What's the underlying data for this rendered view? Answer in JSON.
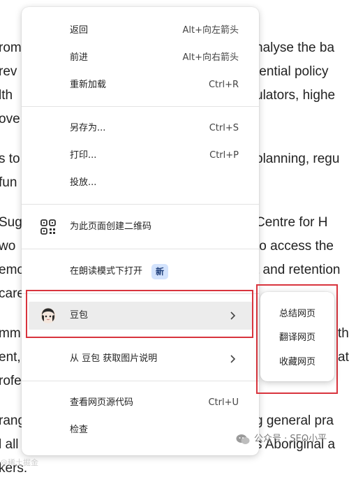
{
  "background_text": [
    {
      "left": "rom",
      "right": "nalyse the ba"
    },
    {
      "left": "rev",
      "right": "tential policy"
    },
    {
      "left": "lth",
      "right": "ulators, highe"
    },
    {
      "left": "ove",
      "right": ""
    },
    {
      "left": "s to",
      "right": "planning, regu"
    },
    {
      "left": "fun",
      "right": ""
    },
    {
      "left": "Sug",
      "right": "Centre for H"
    },
    {
      "left": " wo",
      "right": "to access the"
    },
    {
      "left": "emo",
      "right": "t and retention"
    },
    {
      "left": "care",
      "right": ""
    },
    {
      "left": "mm",
      "right": "th"
    },
    {
      "left": "ent,",
      "right": "at"
    },
    {
      "left": "rofe",
      "right": ""
    },
    {
      "left": "rang",
      "right": "g general pra"
    },
    {
      "left": "l all",
      "right": "s Aboriginal a"
    },
    {
      "left": "kers.",
      "right": ""
    }
  ],
  "menu": {
    "back": {
      "label": "返回",
      "shortcut": "Alt+向左箭头"
    },
    "forward": {
      "label": "前进",
      "shortcut": "Alt+向右箭头"
    },
    "reload": {
      "label": "重新加载",
      "shortcut": "Ctrl+R"
    },
    "save_as": {
      "label": "另存为...",
      "shortcut": "Ctrl+S"
    },
    "print": {
      "label": "打印...",
      "shortcut": "Ctrl+P"
    },
    "cast": {
      "label": "投放..."
    },
    "qr": {
      "label": "为此页面创建二维码"
    },
    "reading_mode": {
      "label": "在朗读模式下打开",
      "badge": "新"
    },
    "doubao": {
      "label": "豆包"
    },
    "image_desc": {
      "label": "从 豆包 获取图片说明"
    },
    "view_source": {
      "label": "查看网页源代码",
      "shortcut": "Ctrl+U"
    },
    "inspect": {
      "label": "检查"
    }
  },
  "submenu": {
    "items": [
      "总结网页",
      "翻译网页",
      "收藏网页"
    ]
  },
  "watermark": {
    "text": "公众号 · SEO小平",
    "left_text": "@稀土掘金"
  },
  "colors": {
    "highlight_box": "#d8343d",
    "badge_bg": "#d3e3fd",
    "hover_bg": "#ececec"
  }
}
